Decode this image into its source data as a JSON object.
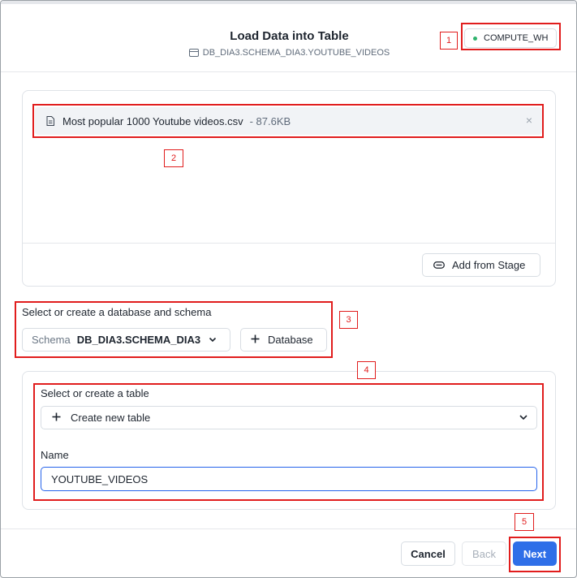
{
  "dialog": {
    "title": "Load Data into Table",
    "path": "DB_DIA3.SCHEMA_DIA3.YOUTUBE_VIDEOS",
    "warehouse": "COMPUTE_WH",
    "warehouse_status_color": "#2fb36d"
  },
  "upload": {
    "file_name": "Most popular 1000 Youtube videos.csv",
    "file_size": "- 87.6KB",
    "remove_glyph": "×",
    "add_from_stage_label": "Add from Stage"
  },
  "database_section": {
    "label": "Select or create a database and schema",
    "schema_prefix": "Schema",
    "schema_value": "DB_DIA3.SCHEMA_DIA3",
    "add_database_label": "Database"
  },
  "table_section": {
    "label": "Select or create a table",
    "selected_option": "Create new table",
    "name_label": "Name",
    "name_value": "YOUTUBE_VIDEOS"
  },
  "footer": {
    "cancel_label": "Cancel",
    "back_label": "Back",
    "next_label": "Next"
  },
  "annotations": [
    "1",
    "2",
    "3",
    "4",
    "5"
  ],
  "colors": {
    "accent": "#2f6fe8",
    "annotation": "#e11d1d"
  }
}
